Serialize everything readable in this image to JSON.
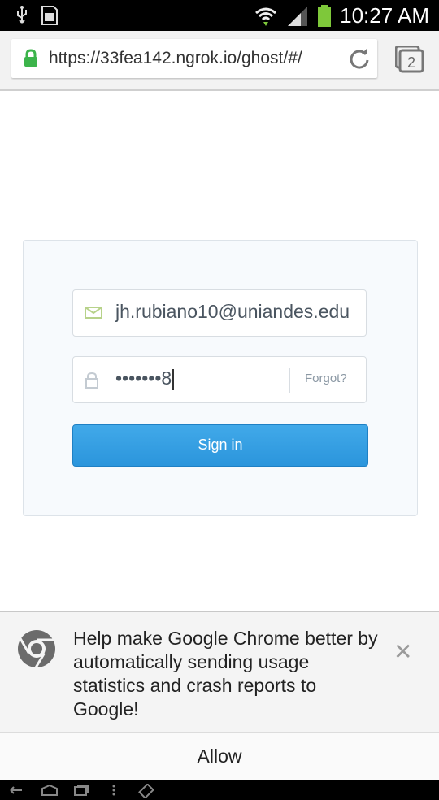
{
  "status_bar": {
    "time": "10:27 AM",
    "icons": [
      "usb-icon",
      "sd-card-icon",
      "wifi-icon",
      "signal-icon",
      "battery-icon"
    ]
  },
  "browser": {
    "url": "https://33fea142.ngrok.io/ghost/#/",
    "tab_count": "2"
  },
  "login": {
    "email_value": "jh.rubiano10@uniandes.edu",
    "password_value": "•••••••8",
    "forgot_label": "Forgot?",
    "signin_label": "Sign in"
  },
  "infobar": {
    "message": "Help make Google Chrome better by automatically sending usage statistics and crash reports to Google!",
    "allow_label": "Allow"
  },
  "colors": {
    "accent": "#2e9ae0",
    "secure_lock": "#3cb44b",
    "battery": "#7ec83a"
  }
}
